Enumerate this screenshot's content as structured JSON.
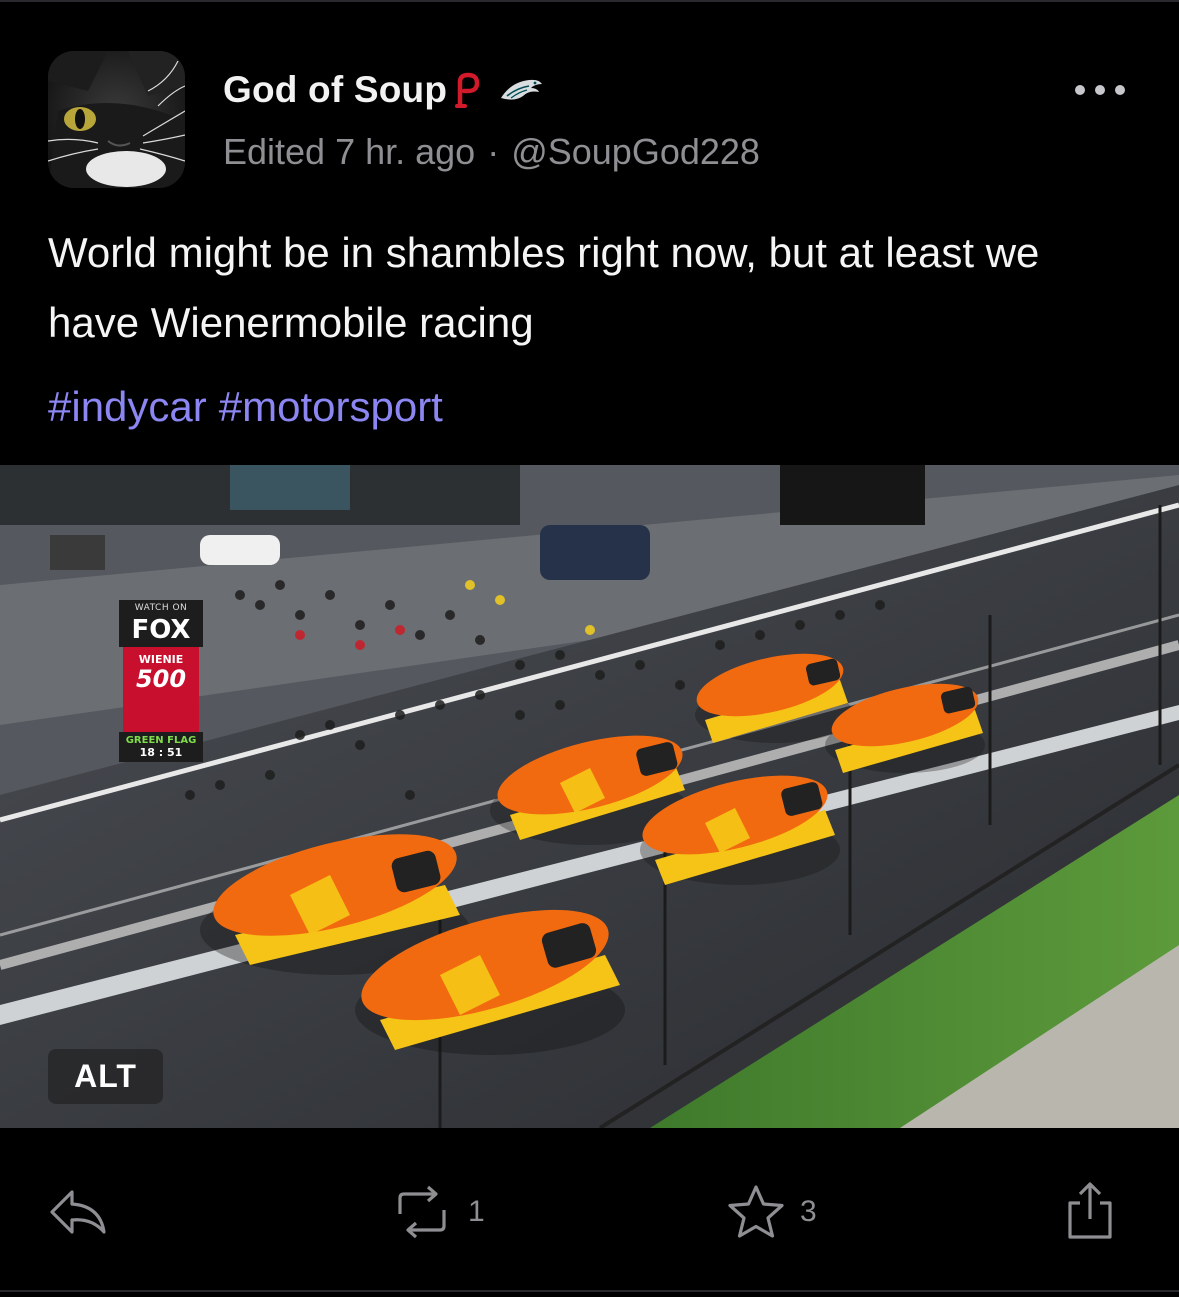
{
  "post": {
    "author": {
      "display_name": "God of Soup",
      "handle": "@SoupGod228",
      "badges": [
        "phillies-p-icon",
        "eagles-icon"
      ]
    },
    "edited": "Edited 7 hr. ago",
    "separator": "·",
    "text": "World might be in shambles right now, but at least we have Wienermobile racing",
    "hashtags": [
      "#indycar",
      "#motorsport"
    ],
    "media": {
      "alt_label": "ALT",
      "overlay": {
        "watch_on": "WATCH ON",
        "network": "FOX",
        "event_line1": "WIENIE",
        "event_line2": "500",
        "status": "GREEN FLAG",
        "clock": "18 : 51"
      }
    }
  },
  "actions": {
    "repost_count": "1",
    "like_count": "3"
  },
  "colors": {
    "background": "#000000",
    "hashtag": "#8b86f2",
    "muted": "#8e8e93",
    "wiener_orange": "#f26a0f",
    "wiener_yellow": "#f5c417"
  }
}
